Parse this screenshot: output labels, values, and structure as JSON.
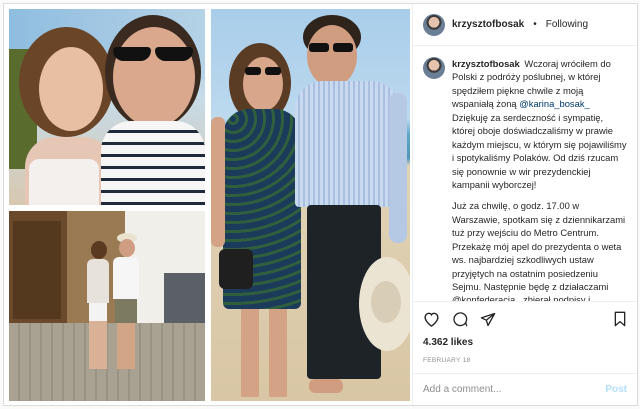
{
  "header": {
    "username": "krzysztofbosak",
    "separator": "•",
    "follow_status": "Following"
  },
  "caption": {
    "username": "krzysztofbosak",
    "para1_before": "Wczoraj wróciłem do Polski z podróży poślubnej, w której spędziłem piękne chwile z moją wspaniałą żoną ",
    "mention": "@karina_bosak_",
    "para1_after": " Dziękuję za serdeczność i sympatię, której oboje doświadczaliśmy w prawie każdym miejscu, w którym się pojawiliśmy i spotykaliśmy Polaków. Od dziś rzucam się ponownie w wir prezydenckiej kampanii wyborczej!",
    "para2": "Już za chwilę, o godz. 17.00 w Warszawie, spotkam się z dziennikarzami tuż przy wejściu do Metro Centrum. Przekażę mój apel do prezydenta o weta ws. najbardziej szkodliwych ustaw przyjętych na ostatnim posiedzeniu Sejmu. Następnie będę z działaczami @konfederacja_ zbierał podpisy i"
  },
  "actions": {
    "likes": "4.362 likes",
    "date": "FEBRUARY 18"
  },
  "comment_box": {
    "placeholder": "Add a comment...",
    "post_label": "Post"
  },
  "colors": {
    "link": "#00376b",
    "post_disabled": "#b2dffc",
    "muted": "#8e8e8e"
  }
}
